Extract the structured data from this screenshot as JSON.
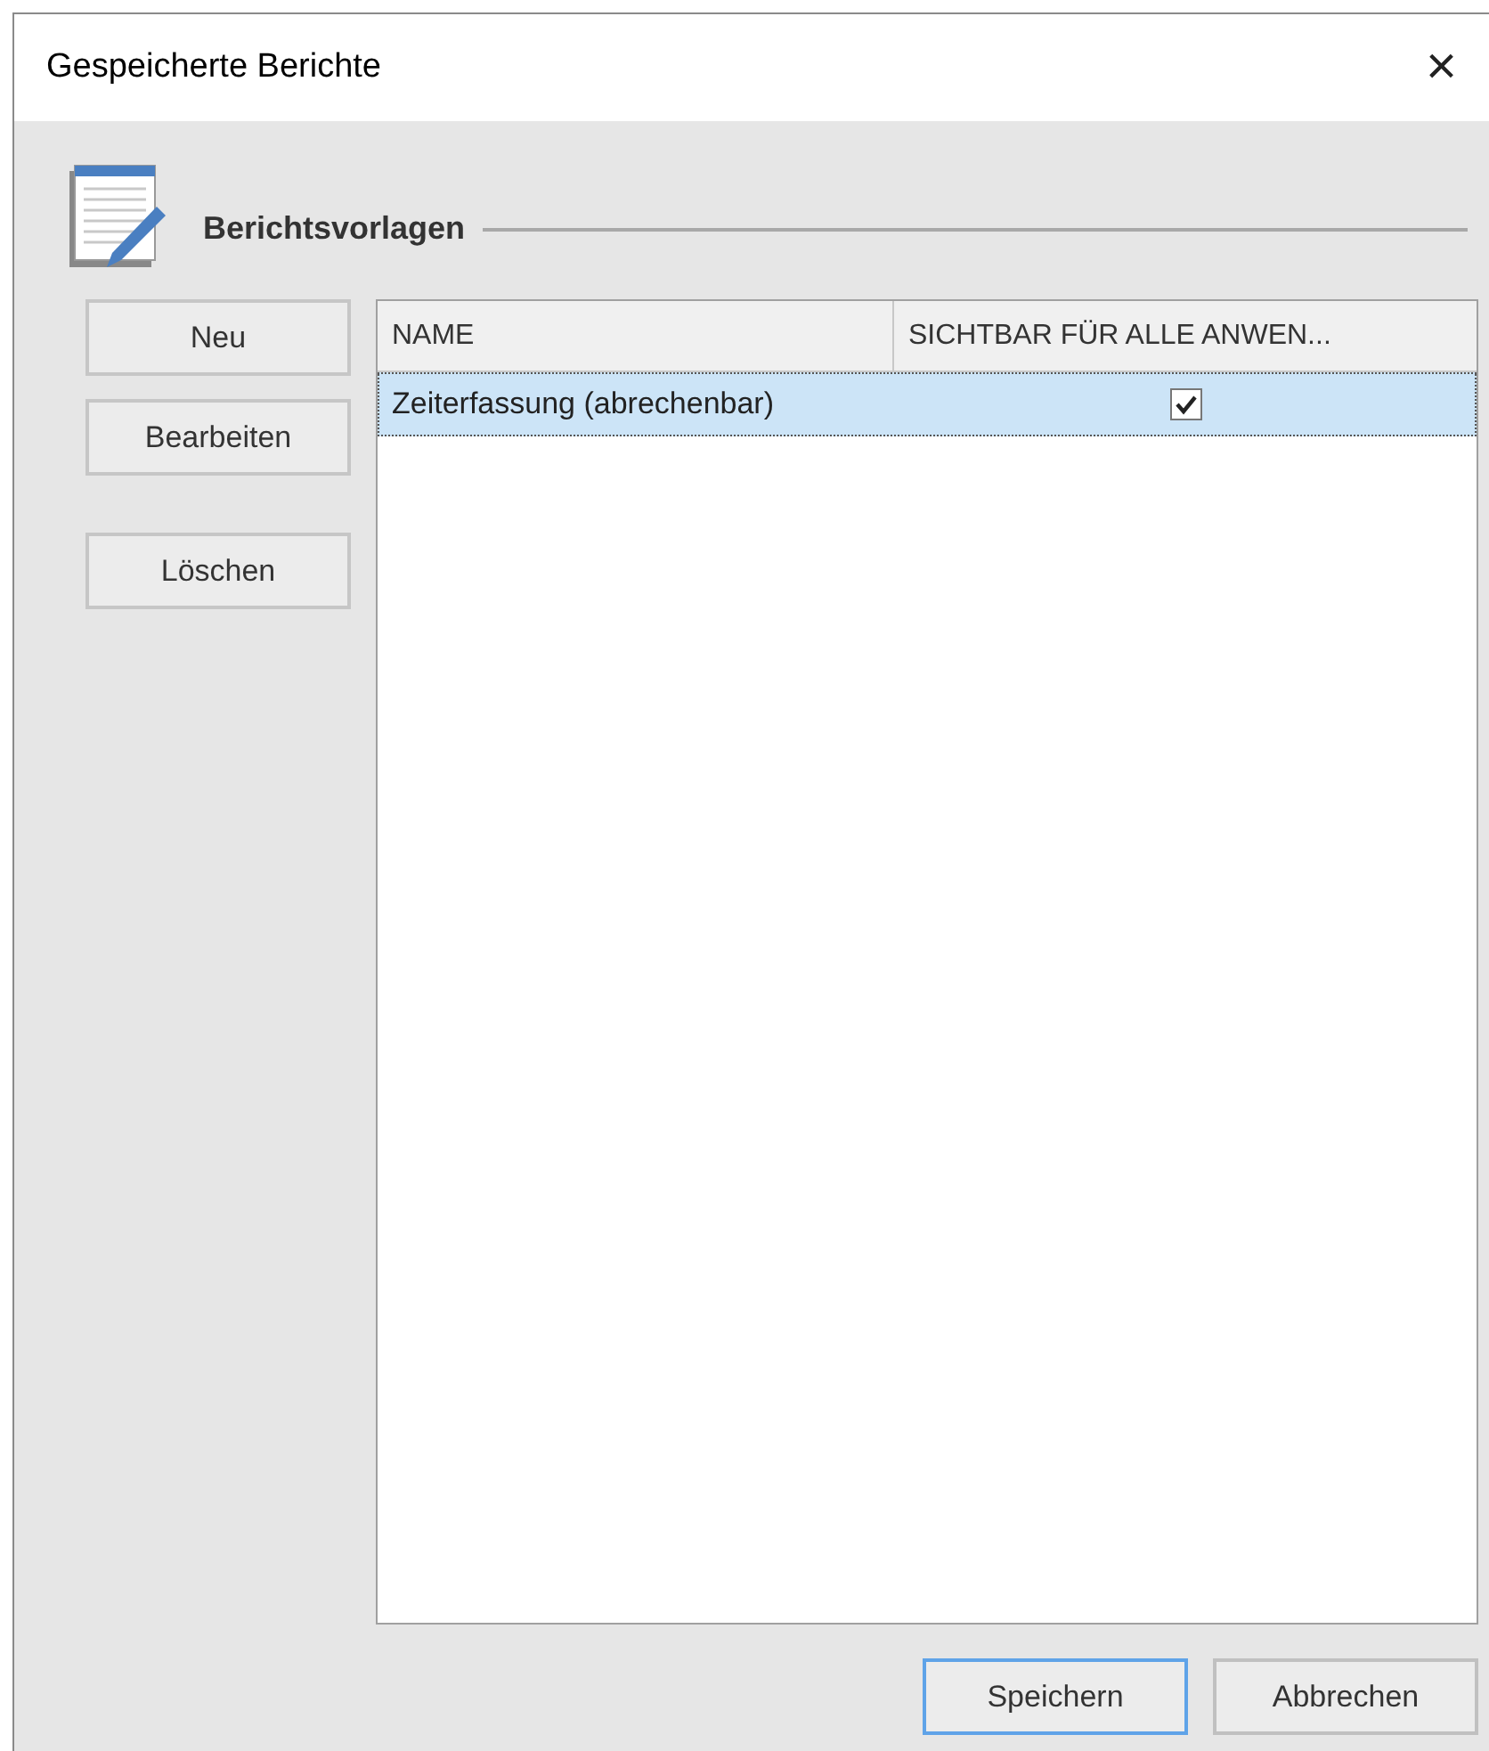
{
  "window": {
    "title": "Gespeicherte Berichte",
    "close": "×"
  },
  "section": {
    "heading": "Berichtsvorlagen"
  },
  "side_buttons": [
    {
      "label": "Neu"
    },
    {
      "label": "Bearbeiten"
    },
    {
      "label": "Löschen"
    }
  ],
  "table": {
    "columns": [
      "NAME",
      "SICHTBAR FÜR ALLE ANWEN..."
    ],
    "rows": [
      {
        "name": "Zeiterfassung (abrechenbar)",
        "checked": true,
        "selected": true
      }
    ]
  },
  "footer_buttons": [
    {
      "label": "Speichern",
      "default": true
    },
    {
      "label": "Abbrechen",
      "default": false
    }
  ]
}
